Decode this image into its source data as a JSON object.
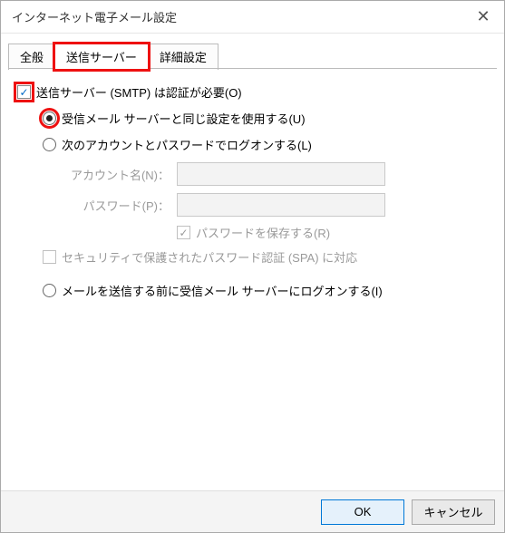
{
  "window": {
    "title": "インターネット電子メール設定"
  },
  "tabs": {
    "general": "全般",
    "outgoing": "送信サーバー",
    "advanced": "詳細設定"
  },
  "content": {
    "smtp_auth_label": "送信サーバー (SMTP) は認証が必要(O)",
    "use_same_settings_label": "受信メール サーバーと同じ設定を使用する(U)",
    "logon_with_label": "次のアカウントとパスワードでログオンする(L)",
    "account_name_label": "アカウント名(N)：",
    "password_label": "パスワード(P)：",
    "remember_password_label": "パスワードを保存する(R)",
    "spa_label": "セキュリティで保護されたパスワード認証 (SPA) に対応",
    "logon_before_send_label": "メールを送信する前に受信メール サーバーにログオンする(I)"
  },
  "buttons": {
    "ok": "OK",
    "cancel": "キャンセル"
  }
}
